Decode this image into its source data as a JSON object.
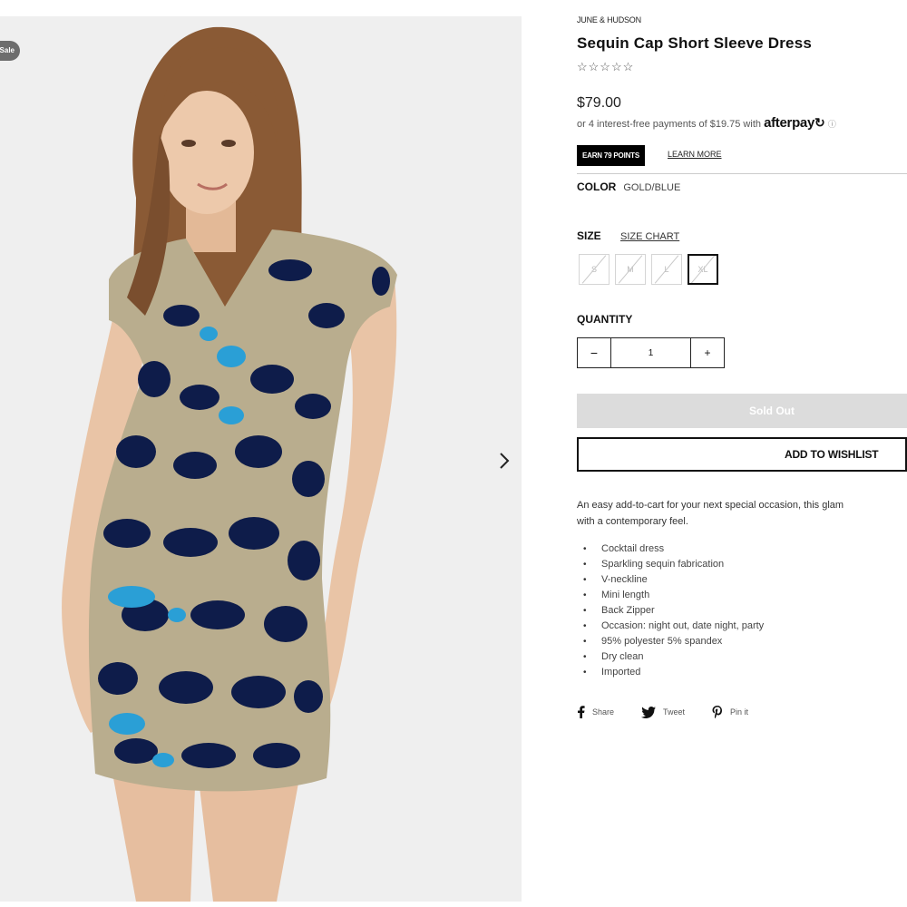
{
  "gallery": {
    "badge": "Sale"
  },
  "product": {
    "vendor": "JUNE & HUDSON",
    "title": "Sequin Cap Short Sleeve Dress",
    "stars": "☆☆☆☆☆",
    "price": "$79.00",
    "afterpay": {
      "text": "or 4 interest-free payments of $19.75 with",
      "brand": "afterpay",
      "info": "ⓘ"
    },
    "points": {
      "label": "EARN 79 POINTS",
      "learn_more": "LEARN MORE"
    },
    "color": {
      "label": "COLOR",
      "value": "GOLD/BLUE"
    },
    "size": {
      "label": "SIZE",
      "chart_link": "SIZE CHART",
      "options": [
        "S",
        "M",
        "L",
        "XL"
      ],
      "selected": "XL"
    },
    "quantity": {
      "label": "QUANTITY",
      "value": "1",
      "minus": "−",
      "plus": "+"
    },
    "sold_out": "Sold Out",
    "wishlist": "ADD TO WISHLIST",
    "description_line1": "An easy add-to-cart for your next special occasion, this glam",
    "description_line2": "with a contemporary feel.",
    "bullets": [
      "Cocktail dress",
      "Sparkling sequin fabrication",
      "V-neckline",
      "Mini length",
      "Back Zipper",
      "Occasion: night out, date night, party",
      "95% polyester 5% spandex",
      "Dry clean",
      "Imported"
    ],
    "share": {
      "facebook": "Share",
      "twitter": "Tweet",
      "pinterest": "Pin it"
    }
  },
  "colors": {
    "dress_gold": "#b9ad8e",
    "dress_navy": "#0e1c4a",
    "dress_blue": "#2a9fd6",
    "skin": "#e9c4a6",
    "hair": "#8a5a35"
  }
}
